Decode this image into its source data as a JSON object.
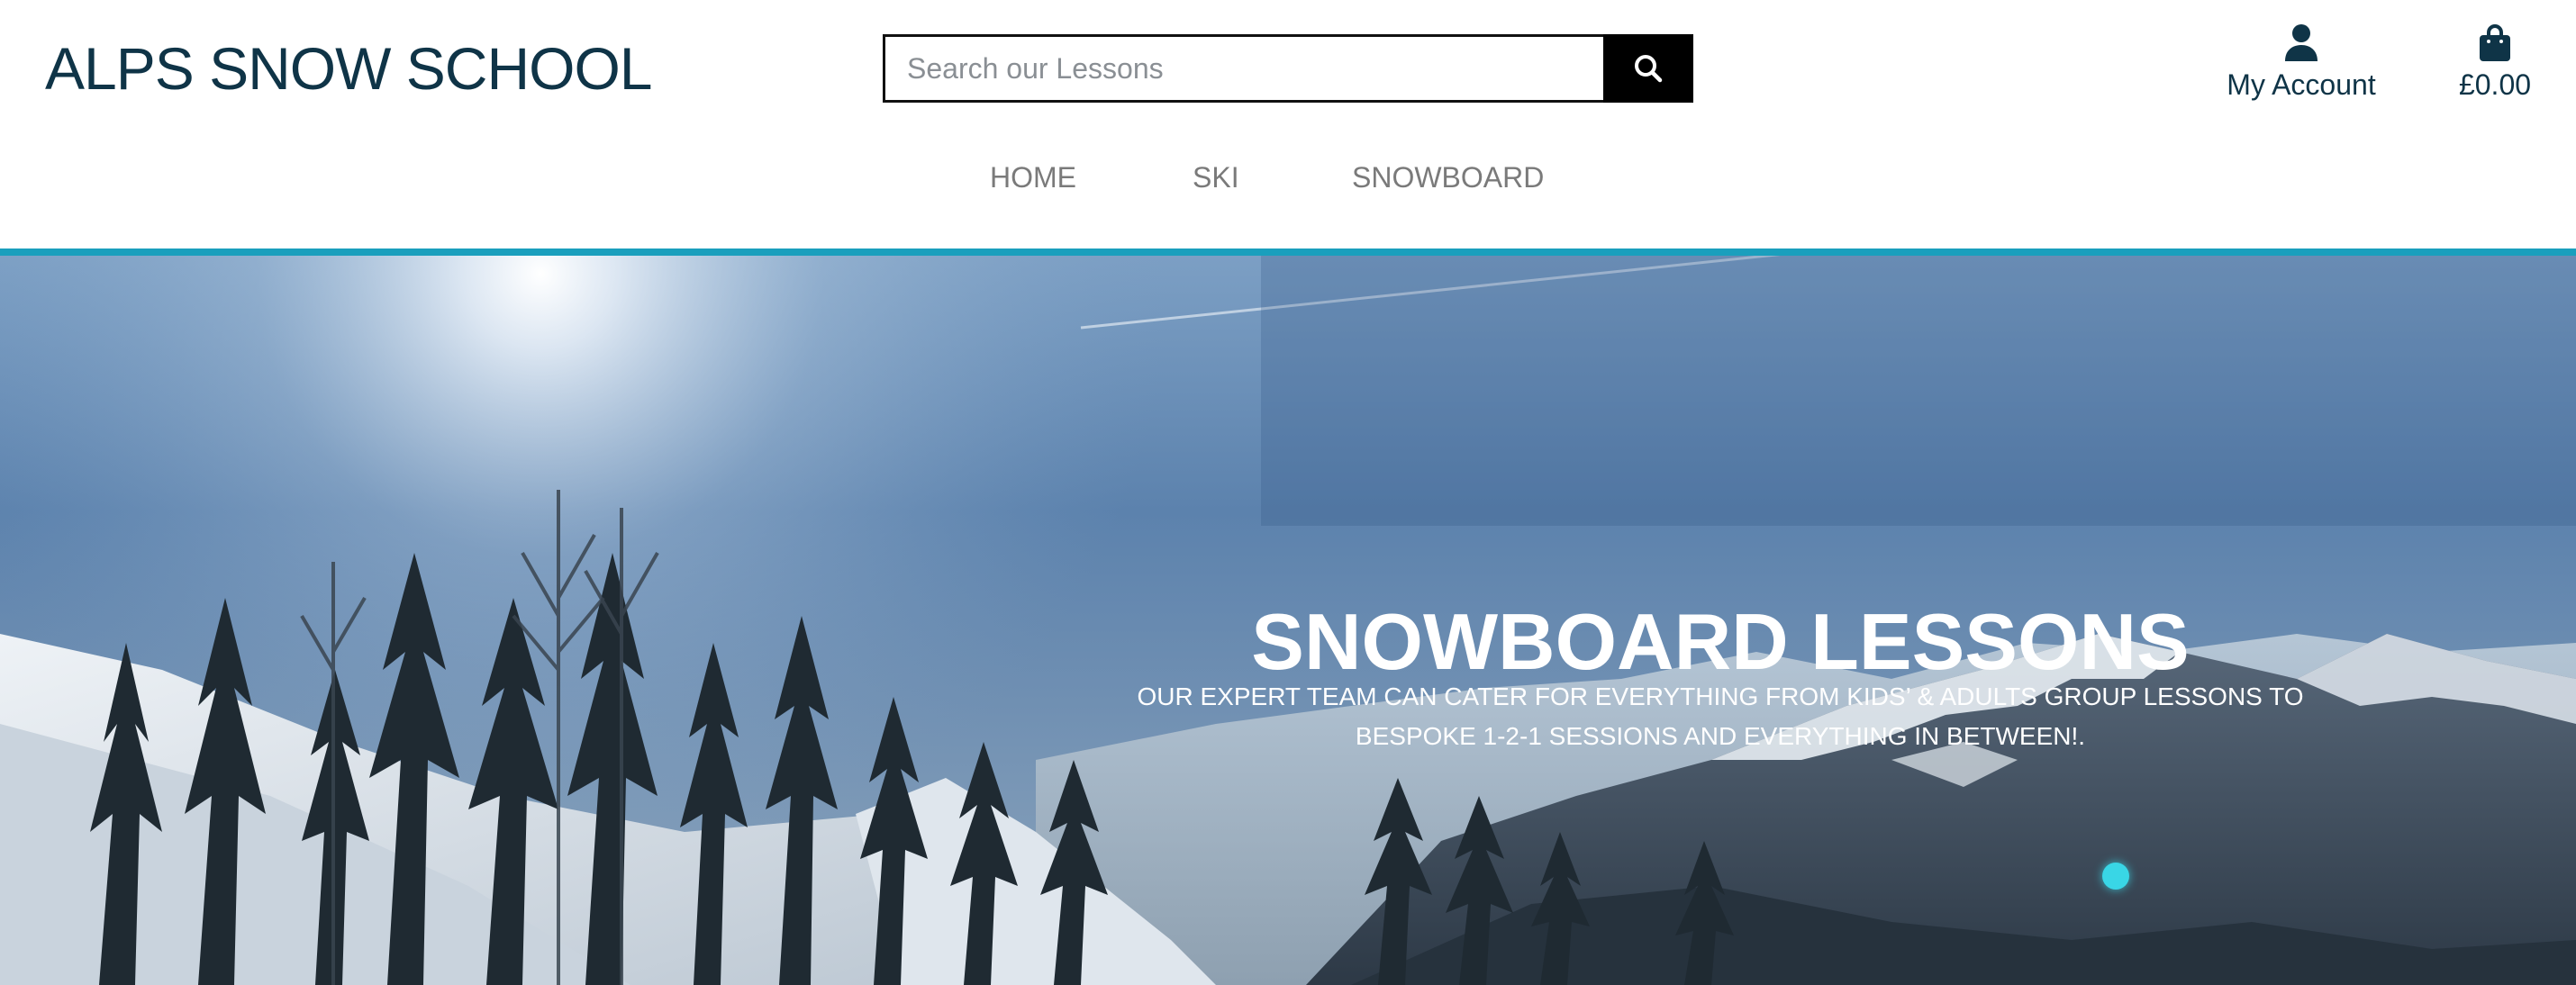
{
  "brand": {
    "name": "ALPS SNOW SCHOOL"
  },
  "search": {
    "placeholder": "Search our Lessons",
    "value": "",
    "icon": "search-icon"
  },
  "account": {
    "label": "My Account",
    "icon": "user-icon"
  },
  "cart": {
    "label": "£0.00",
    "icon": "shopping-bag-icon"
  },
  "nav": {
    "items": [
      {
        "label": "HOME"
      },
      {
        "label": "SKI"
      },
      {
        "label": "SNOWBOARD"
      }
    ]
  },
  "hero": {
    "title": "SNOWBOARD LESSONS",
    "subtitle": "OUR EXPERT TEAM CAN CATER FOR EVERYTHING FROM KIDS’ & ADULTS GROUP LESSONS TO BESPOKE 1-2-1 SESSIONS AND EVERYTHING IN BETWEEN!."
  },
  "colors": {
    "brand_text": "#0f3447",
    "accent_bar": "#1a9fbd",
    "nav_text": "#7a7a7a",
    "search_button": "#000000",
    "hero_text": "#ffffff"
  }
}
